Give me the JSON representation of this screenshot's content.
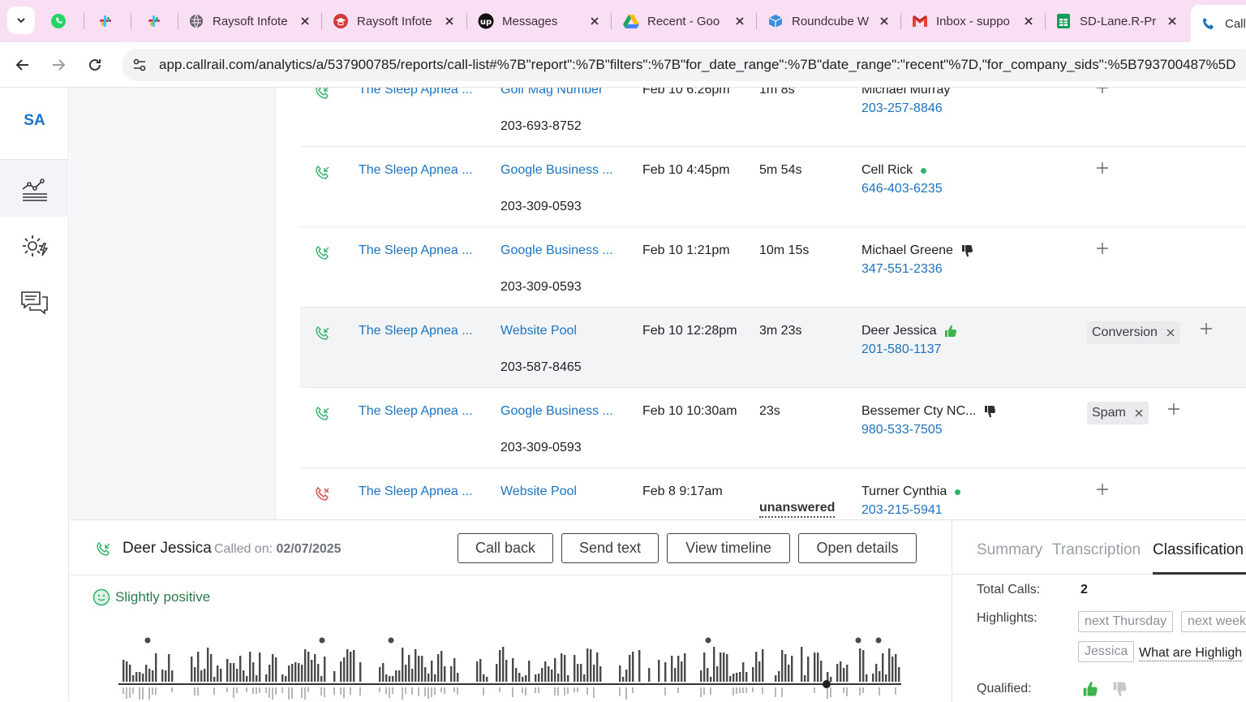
{
  "browser": {
    "tabs": [
      {
        "title": "",
        "icon": "whatsapp-icon"
      },
      {
        "title": "",
        "icon": "slack-icon"
      },
      {
        "title": "",
        "icon": "slack-icon"
      },
      {
        "title": "Raysoft Infote",
        "icon": "globe-icon"
      },
      {
        "title": "Raysoft Infote",
        "icon": "graduation-cap-icon"
      },
      {
        "title": "Messages",
        "icon": "upwork-icon"
      },
      {
        "title": "Recent - Goo",
        "icon": "google-drive-icon"
      },
      {
        "title": "Roundcube W",
        "icon": "roundcube-icon"
      },
      {
        "title": "Inbox - suppo",
        "icon": "gmail-icon"
      },
      {
        "title": "SD-Lane.R-Pr",
        "icon": "google-sheets-icon"
      },
      {
        "title": "Call",
        "icon": "callrail-icon"
      }
    ],
    "url": "app.callrail.com/analytics/a/537900785/reports/call-list#%7B\"report\":%7B\"filters\":%7B\"for_date_range\":%7B\"date_range\":\"recent\"%7D,\"for_company_sids\":%5B793700487%5D"
  },
  "nav": {
    "logo": "SA",
    "items": [
      "analytics-icon",
      "settings-lightning-icon",
      "chat-bubbles-icon"
    ]
  },
  "calls": [
    {
      "company": "The Sleep Apnea ...",
      "source": "Golf Mag Number",
      "tracking_number": "203-693-8752",
      "date": "Feb 10 6:26pm",
      "duration": "1m 8s",
      "caller": "Michael Murray",
      "phone": "203-257-8846",
      "status": "answered",
      "indicator": "none",
      "tags": []
    },
    {
      "company": "The Sleep Apnea ...",
      "source": "Google Business ...",
      "tracking_number": "203-309-0593",
      "date": "Feb 10 4:45pm",
      "duration": "5m 54s",
      "caller": "Cell Rick",
      "phone": "646-403-6235",
      "status": "answered",
      "indicator": "dot",
      "tags": []
    },
    {
      "company": "The Sleep Apnea ...",
      "source": "Google Business ...",
      "tracking_number": "203-309-0593",
      "date": "Feb 10 1:21pm",
      "duration": "10m 15s",
      "caller": "Michael Greene",
      "phone": "347-551-2336",
      "status": "answered",
      "indicator": "thumbs-down",
      "tags": []
    },
    {
      "company": "The Sleep Apnea ...",
      "source": "Website Pool",
      "tracking_number": "203-587-8465",
      "date": "Feb 10 12:28pm",
      "duration": "3m 23s",
      "caller": "Deer Jessica",
      "phone": "201-580-1137",
      "status": "answered",
      "indicator": "thumbs-up",
      "tags": [
        "Conversion"
      ]
    },
    {
      "company": "The Sleep Apnea ...",
      "source": "Google Business ...",
      "tracking_number": "203-309-0593",
      "date": "Feb 10 10:30am",
      "duration": "23s",
      "caller": "Bessemer Cty NC...",
      "phone": "980-533-7505",
      "status": "answered",
      "indicator": "thumbs-down",
      "tags": [
        "Spam"
      ]
    },
    {
      "company": "The Sleep Apnea ...",
      "source": "Website Pool",
      "tracking_number": "",
      "date": "Feb 8 9:17am",
      "duration": "unanswered",
      "caller": "Turner Cynthia",
      "phone": "203-215-5941",
      "status": "unanswered",
      "indicator": "dot",
      "tags": []
    }
  ],
  "detail": {
    "name": "Deer Jessica",
    "called_label": "Called on:",
    "called_date": "02/07/2025",
    "buttons": {
      "call_back": "Call back",
      "send_text": "Send text",
      "view_timeline": "View timeline",
      "open_details": "Open details"
    },
    "sentiment": "Slightly positive",
    "tabs": {
      "summary": "Summary",
      "transcription": "Transcription",
      "classification": "Classification"
    },
    "total_calls_label": "Total Calls:",
    "total_calls": "2",
    "highlights_label": "Highlights:",
    "highlights": [
      "next Thursday",
      "next week",
      "Jessica"
    ],
    "highlights_link": "What are Highligh",
    "qualified_label": "Qualified:"
  },
  "colors": {
    "link": "#1e73be",
    "positive": "#2fb36b",
    "missed": "#d94a4a",
    "answered": "#2fb36b"
  }
}
